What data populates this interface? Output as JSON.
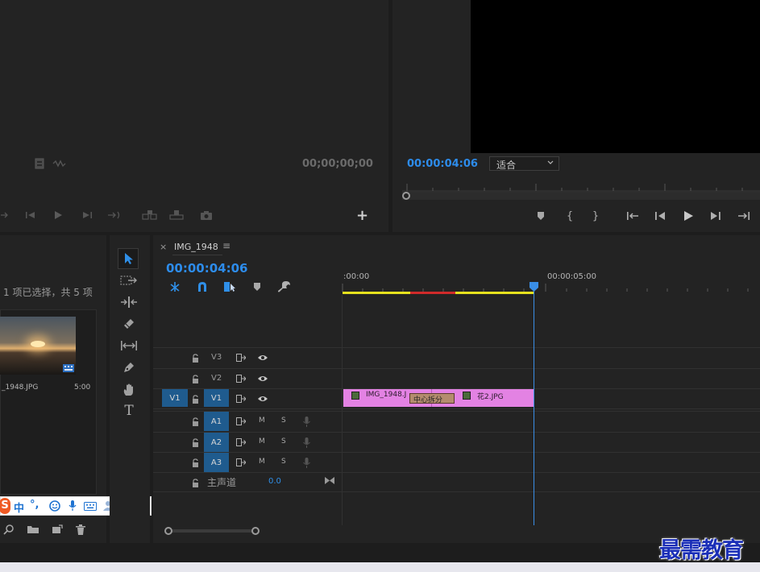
{
  "source_monitor": {
    "timecode": "00;00;00;00",
    "add_button": "+"
  },
  "program_monitor": {
    "timecode": "00:00:04:06",
    "fit_select": "适合"
  },
  "project_panel": {
    "selection_status": "1 项已选择，共 5 项",
    "clip_name": "_1948.JPG",
    "clip_duration": "5:00"
  },
  "ime_toolbar": {
    "logo": "S",
    "chinese_mode": "中",
    "punct_mode": "°,"
  },
  "timeline": {
    "tab_close": "×",
    "tab_title": "IMG_1948",
    "tab_menu": "≡",
    "timecode": "00:00:04:06",
    "ruler_start": ":00:00",
    "ruler_mid": "00:00:05:00",
    "tracks": {
      "v3": "V3",
      "v2": "V2",
      "v1": "V1",
      "v1_source": "V1",
      "a1": "A1",
      "a2": "A2",
      "a3": "A3",
      "master": "主声道",
      "master_value": "0.0",
      "mute": "M",
      "solo": "S"
    },
    "clips": {
      "clip1_name": "IMG_1948.J",
      "clip2_name": "花2.JPG",
      "transition_label": "中心拆分"
    },
    "colors": {
      "clip": "#e382e3",
      "playhead": "#3a8ee6",
      "render_yellow": "#e6e11e",
      "render_red": "#d02a2a",
      "target_blue": "#1f5b8e"
    }
  },
  "watermark": "最需教育"
}
